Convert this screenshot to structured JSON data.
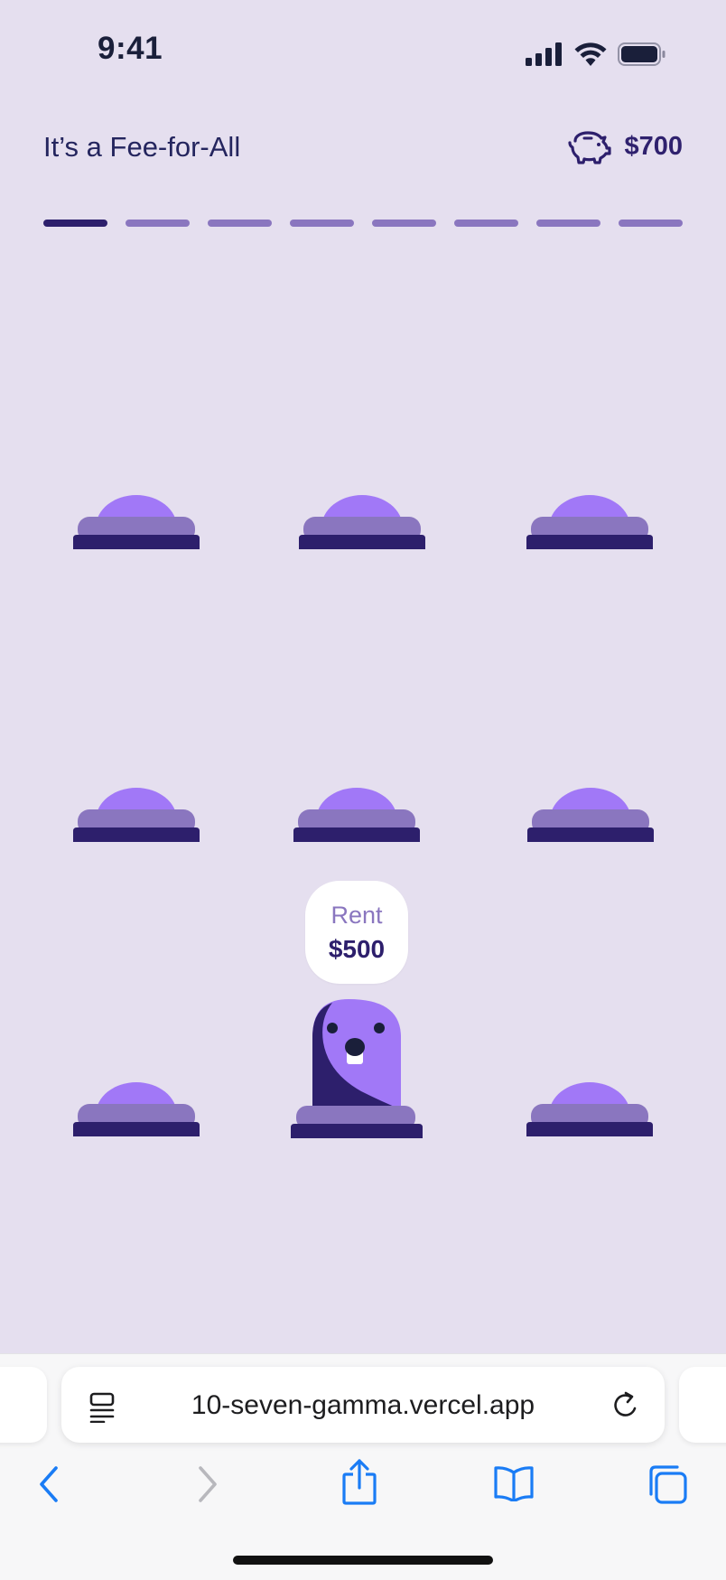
{
  "status_bar": {
    "time": "9:41"
  },
  "header": {
    "title": "It’s a Fee-for-All",
    "balance": "$700"
  },
  "progress": {
    "total": 8,
    "current": 1
  },
  "mole": {
    "label": "Rent",
    "amount": "$500"
  },
  "browser": {
    "url": "10-seven-gamma.vercel.app"
  },
  "colors": {
    "background": "#e5dfef",
    "dark_purple": "#2d1f6c",
    "mid_purple": "#8a76bf",
    "mole_purple": "#a178f7",
    "ios_blue": "#1a7cf5"
  },
  "icons": [
    "signal-icon",
    "wifi-icon",
    "battery-icon",
    "piggy-bank-icon",
    "reader-icon",
    "reload-icon",
    "back-icon",
    "forward-icon",
    "share-icon",
    "bookmarks-icon",
    "tabs-icon"
  ]
}
